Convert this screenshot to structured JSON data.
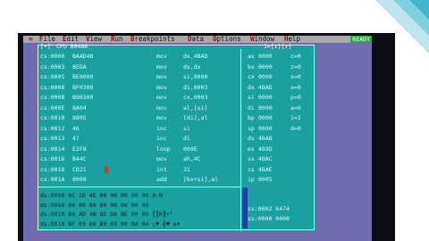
{
  "menu": {
    "system_label": "≡",
    "items": [
      {
        "hot": "F",
        "rest": "ile"
      },
      {
        "hot": "E",
        "rest": "dit"
      },
      {
        "hot": "V",
        "rest": "iew"
      },
      {
        "hot": "R",
        "rest": "un"
      },
      {
        "hot": "B",
        "rest": "reakpoints"
      },
      {
        "hot": "D",
        "rest": "ata"
      },
      {
        "hot": "O",
        "rest": "ptions"
      },
      {
        "hot": "W",
        "rest": "indow"
      },
      {
        "hot": "H",
        "rest": "elp"
      }
    ],
    "status": "READY"
  },
  "cpu_window": {
    "close_box": "[•]",
    "title": "CPU 80486",
    "right_title": "1=[↕][↑]",
    "code_rows": [
      {
        "addr": "cs:0000",
        "bytes": "BAAD4B",
        "op": "mov",
        "args": "dx,4BAD"
      },
      {
        "addr": "cs:0003",
        "bytes": "8EDA",
        "op": "mov",
        "args": "ds,dx"
      },
      {
        "addr": "cs:0005",
        "bytes": "BE0000",
        "op": "mov",
        "args": "si,0000"
      },
      {
        "addr": "cs:0008",
        "bytes": "BF0300",
        "op": "mov",
        "args": "di,0003"
      },
      {
        "addr": "cs:000B",
        "bytes": "B90300",
        "op": "mov",
        "args": "cx,0003"
      },
      {
        "addr": "cs:000E",
        "bytes": "8A04",
        "op": "mov",
        "args": "al,[si]"
      },
      {
        "addr": "cs:0010",
        "bytes": "8805",
        "op": "mov",
        "args": "[di],al"
      },
      {
        "addr": "cs:0012",
        "bytes": "46",
        "op": "inc",
        "args": "si"
      },
      {
        "addr": "cs:0013",
        "bytes": "47",
        "op": "inc",
        "args": "di"
      },
      {
        "addr": "cs:0014",
        "bytes": "E2F8",
        "op": "loop",
        "args": "000E"
      },
      {
        "addr": "cs:0016",
        "bytes": "B44C",
        "op": "mov",
        "args": "ah,4C"
      },
      {
        "addr": "cs:0018",
        "bytes": "CD21",
        "op": "int",
        "args": "21"
      },
      {
        "addr": "cs:001A",
        "bytes": "0000",
        "op": "add",
        "args": "[bx+si],al"
      }
    ],
    "registers": [
      {
        "name": "ax",
        "value": "0000"
      },
      {
        "name": "bx",
        "value": "0000"
      },
      {
        "name": "cx",
        "value": "0000"
      },
      {
        "name": "dx",
        "value": "4BAD"
      },
      {
        "name": "si",
        "value": "0000"
      },
      {
        "name": "di",
        "value": "0000"
      },
      {
        "name": "bp",
        "value": "0000"
      },
      {
        "name": "sp",
        "value": "0000"
      },
      {
        "name": "ds",
        "value": "4BAB"
      },
      {
        "name": "es",
        "value": "489D"
      },
      {
        "name": "ss",
        "value": "4BAC"
      },
      {
        "name": "cs",
        "value": "4BAE"
      },
      {
        "name": "ip",
        "value": "0005"
      }
    ],
    "flags": [
      "c=0",
      "z=0",
      "s=0",
      "o=0",
      "p=0",
      "a=0",
      "i=1",
      "d=0"
    ],
    "dump_rows": [
      "ds:0000 0C 2D 4E 00 00 00 00 00 0-N",
      "ds:0008 00 00 00 00 00 00 00 00",
      "ds:0010 BA AD 4B 8E DA BE 00 00 ║║K╫r┘",
      "ds:0018 BF 03 00 B9 03 00 8A 04 ┐♥ ╣♥ è♦"
    ],
    "stack_rows": [
      {
        "addr": "ss:0002",
        "value": "6474"
      },
      {
        "addr": "ss:0000",
        "value": "0000"
      }
    ]
  }
}
